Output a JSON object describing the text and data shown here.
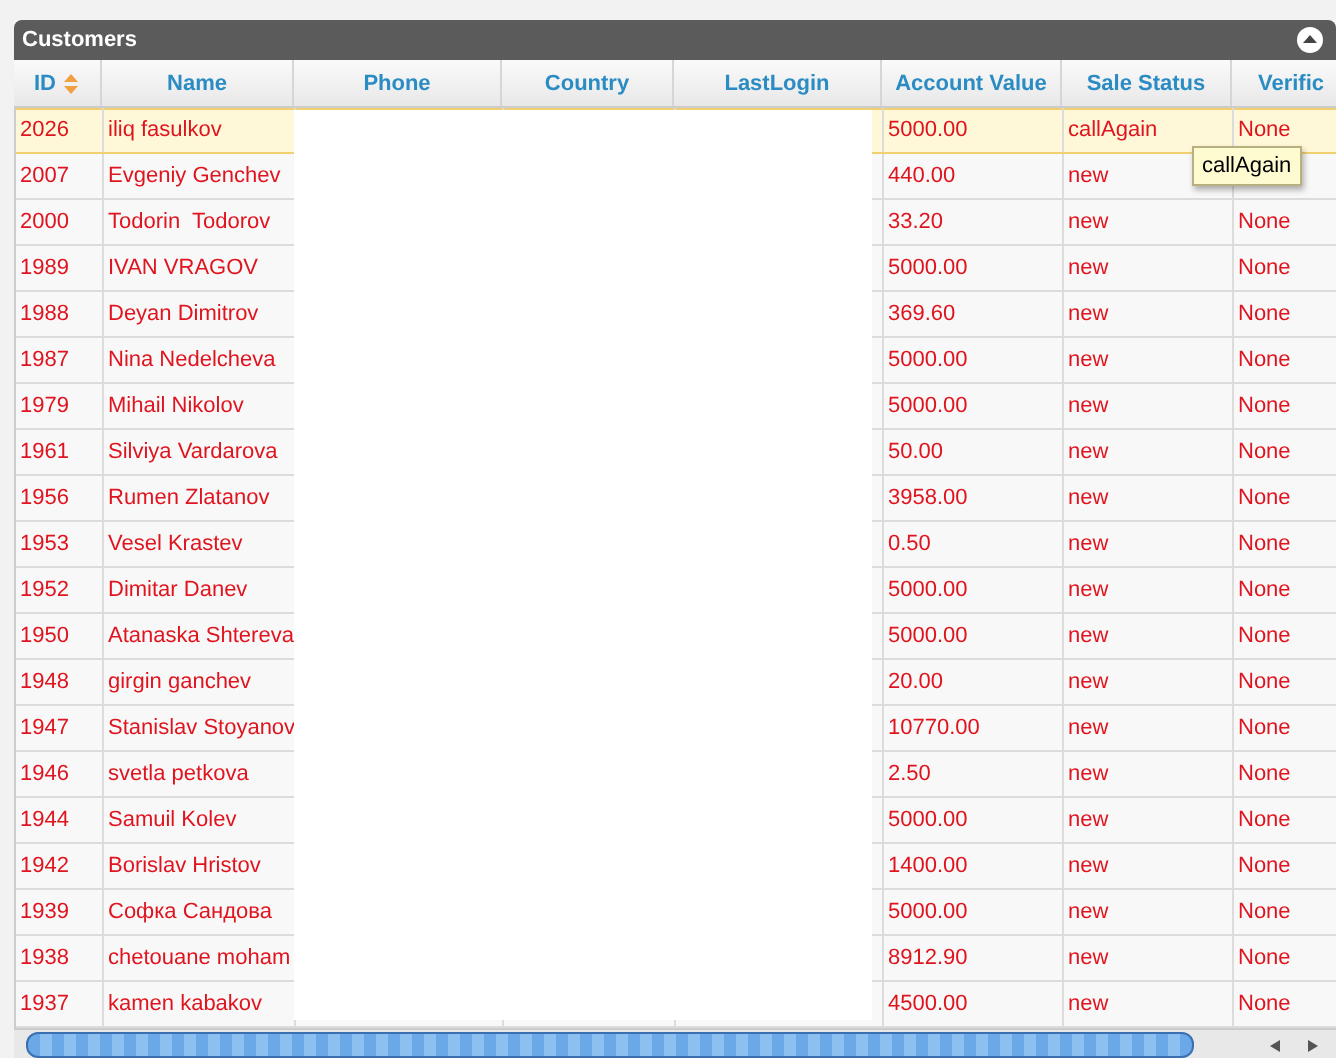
{
  "panel": {
    "title": "Customers",
    "collapsed": false
  },
  "columns": [
    {
      "label": "ID",
      "sortable": true
    },
    {
      "label": "Name",
      "sortable": false
    },
    {
      "label": "Phone",
      "sortable": false
    },
    {
      "label": "Country",
      "sortable": false
    },
    {
      "label": "LastLogin",
      "sortable": false
    },
    {
      "label": "Account Value",
      "sortable": false
    },
    {
      "label": "Sale Status",
      "sortable": false
    },
    {
      "label": "Verific",
      "sortable": false
    }
  ],
  "rows": [
    {
      "id": "2026",
      "name": "iliq fasulkov",
      "account_value": "5000.00",
      "sale_status": "callAgain",
      "verific": "None",
      "selected": true
    },
    {
      "id": "2007",
      "name": "Evgeniy Genchev",
      "account_value": "440.00",
      "sale_status": "new",
      "selected": false
    },
    {
      "id": "2000",
      "name": "Todorin  Todorov",
      "account_value": "33.20",
      "sale_status": "new",
      "verific": "None",
      "selected": false
    },
    {
      "id": "1989",
      "name": "IVAN VRAGOV",
      "account_value": "5000.00",
      "sale_status": "new",
      "verific": "None",
      "selected": false
    },
    {
      "id": "1988",
      "name": "Deyan Dimitrov",
      "account_value": "369.60",
      "sale_status": "new",
      "verific": "None",
      "selected": false
    },
    {
      "id": "1987",
      "name": "Nina Nedelcheva",
      "account_value": "5000.00",
      "sale_status": "new",
      "verific": "None",
      "selected": false
    },
    {
      "id": "1979",
      "name": "Mihail Nikolov",
      "account_value": "5000.00",
      "sale_status": "new",
      "verific": "None",
      "selected": false
    },
    {
      "id": "1961",
      "name": "Silviya Vardarova",
      "account_value": "50.00",
      "sale_status": "new",
      "verific": "None",
      "selected": false
    },
    {
      "id": "1956",
      "name": "Rumen Zlatanov",
      "account_value": "3958.00",
      "sale_status": "new",
      "verific": "None",
      "selected": false
    },
    {
      "id": "1953",
      "name": "Vesel Krastev",
      "account_value": "0.50",
      "sale_status": "new",
      "verific": "None",
      "selected": false
    },
    {
      "id": "1952",
      "name": "Dimitar Danev",
      "account_value": "5000.00",
      "sale_status": "new",
      "verific": "None",
      "selected": false
    },
    {
      "id": "1950",
      "name": "Atanaska Shtereva",
      "account_value": "5000.00",
      "sale_status": "new",
      "verific": "None",
      "selected": false
    },
    {
      "id": "1948",
      "name": "girgin ganchev",
      "account_value": "20.00",
      "sale_status": "new",
      "verific": "None",
      "selected": false
    },
    {
      "id": "1947",
      "name": "Stanislav Stoyanov",
      "account_value": "10770.00",
      "sale_status": "new",
      "verific": "None",
      "selected": false
    },
    {
      "id": "1946",
      "name": "svetla petkova",
      "account_value": "2.50",
      "sale_status": "new",
      "verific": "None",
      "selected": false
    },
    {
      "id": "1944",
      "name": "Samuil Kolev",
      "account_value": "5000.00",
      "sale_status": "new",
      "verific": "None",
      "selected": false
    },
    {
      "id": "1942",
      "name": "Borislav Hristov",
      "account_value": "1400.00",
      "sale_status": "new",
      "verific": "None",
      "selected": false
    },
    {
      "id": "1939",
      "name": "Софка Сандова",
      "account_value": "5000.00",
      "sale_status": "new",
      "verific": "None",
      "selected": false
    },
    {
      "id": "1938",
      "name": "chetouane moham",
      "account_value": "8912.90",
      "sale_status": "new",
      "verific": "None",
      "selected": false
    },
    {
      "id": "1937",
      "name": "kamen kabakov",
      "account_value": "4500.00",
      "sale_status": "new",
      "verific": "None",
      "selected": false
    }
  ],
  "tooltip": {
    "text": "callAgain"
  }
}
